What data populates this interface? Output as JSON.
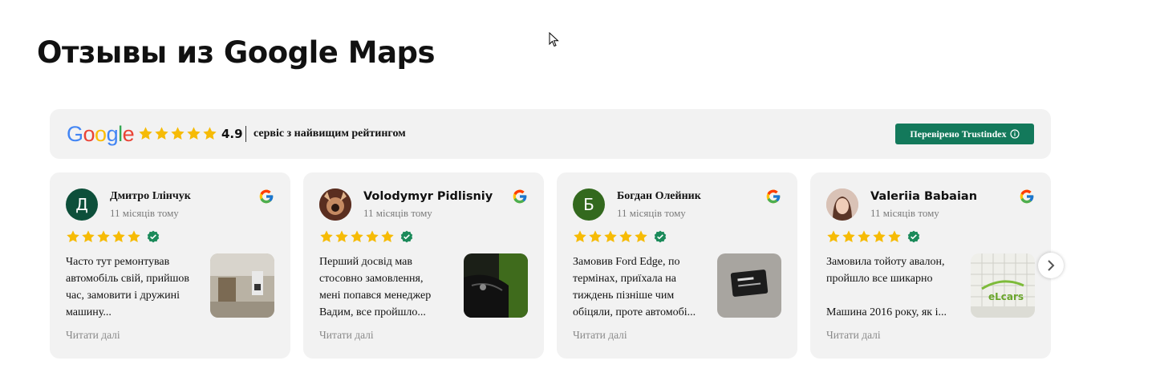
{
  "page": {
    "title": "Отзывы из Google Maps"
  },
  "widget": {
    "logo_text": "Google",
    "rating": "4.9",
    "rating_text": "сервіс з найвищим рейтингом",
    "verified_label": "Перевірено Trustindex",
    "verified_icon": "info-icon",
    "star_color": "#f6bb06",
    "verified_color": "#13795b"
  },
  "reviews": [
    {
      "author": "Дмитро Ілінчук",
      "initial": "Д",
      "avatar_color": "#0d4f3a",
      "date": "11 місяців тому",
      "stars": 5,
      "lines": [
        "Часто тут ремонтував",
        "автомобіль свій, прийшов",
        "час, замовити і дружині",
        "машину..."
      ],
      "read_more": "Читати далі"
    },
    {
      "author": "Volodymyr Pidlisniy",
      "initial": "",
      "avatar_color": "#6b3a2a",
      "date": "11 місяців тому",
      "stars": 5,
      "lines": [
        "Перший досвід мав",
        "стосовно замовлення,",
        "мені попався менеджер",
        "Вадим, все пройшло..."
      ],
      "read_more": "Читати далі"
    },
    {
      "author": "Богдан Олейник",
      "initial": "Б",
      "avatar_color": "#33691e",
      "date": "11 місяців тому",
      "stars": 5,
      "lines": [
        "Замовив Ford Edge, по",
        "термінах, приїхала на",
        "тиждень пізніше чим",
        "обіцяли, проте автомобі..."
      ],
      "read_more": "Читати далі"
    },
    {
      "author": "Valeriia Babaian",
      "initial": "",
      "avatar_color": "#c9a79a",
      "date": "11 місяців тому",
      "stars": 5,
      "lines": [
        "Замовила тойоту авалон,",
        "пройшло все шикарно",
        "",
        "Машина 2016 року, як і..."
      ],
      "read_more": "Читати далі"
    }
  ]
}
